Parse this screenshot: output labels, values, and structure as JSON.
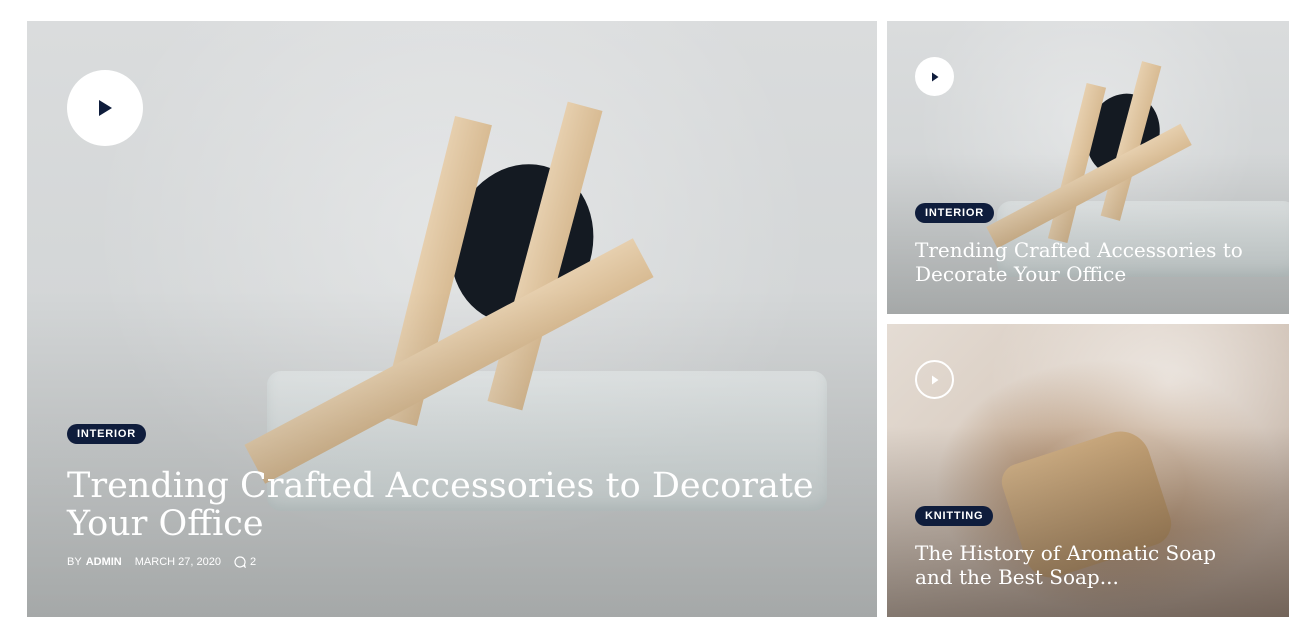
{
  "featured": {
    "category": "INTERIOR",
    "title": "Trending Crafted Accessories to Decorate Your Office",
    "by_prefix": "BY",
    "author": "ADMIN",
    "date": "MARCH 27, 2020",
    "comments": "2"
  },
  "side_posts": [
    {
      "category": "INTERIOR",
      "title": "Trending Crafted Accessories to Decorate Your Office"
    },
    {
      "category": "KNITTING",
      "title": "The History of Aromatic Soap and the Best Soap..."
    }
  ],
  "colors": {
    "badge": "#0f1d3c",
    "text": "#ffffff"
  },
  "icons": {
    "play": "play-icon",
    "comment": "comment-icon"
  }
}
